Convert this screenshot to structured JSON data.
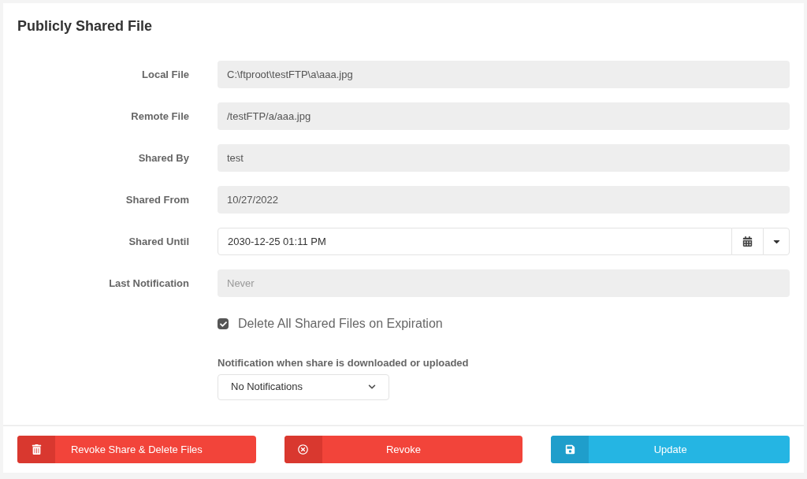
{
  "title": "Publicly Shared File",
  "fields": [
    {
      "label": "Local File",
      "kind": "readonly",
      "value": "C:\\ftproot\\testFTP\\a\\aaa.jpg"
    },
    {
      "label": "Remote File",
      "kind": "readonly",
      "value": "/testFTP/a/aaa.jpg"
    },
    {
      "label": "Shared By",
      "kind": "readonly",
      "value": "test"
    },
    {
      "label": "Shared From",
      "kind": "readonly",
      "value": "10/27/2022"
    },
    {
      "label": "Shared Until",
      "kind": "datetime",
      "value": "2030-12-25 01:11 PM"
    },
    {
      "label": "Last Notification",
      "kind": "readonly",
      "placeholder": "Never"
    }
  ],
  "delete_checkbox": {
    "label": "Delete All Shared Files on Expiration",
    "checked": true
  },
  "notification": {
    "label": "Notification when share is downloaded or uploaded",
    "value": "No Notifications"
  },
  "buttons": [
    {
      "label": "Revoke Share & Delete Files",
      "kind": "delete"
    },
    {
      "label": "Revoke",
      "kind": "revoke"
    },
    {
      "label": "Update",
      "kind": "update"
    }
  ]
}
